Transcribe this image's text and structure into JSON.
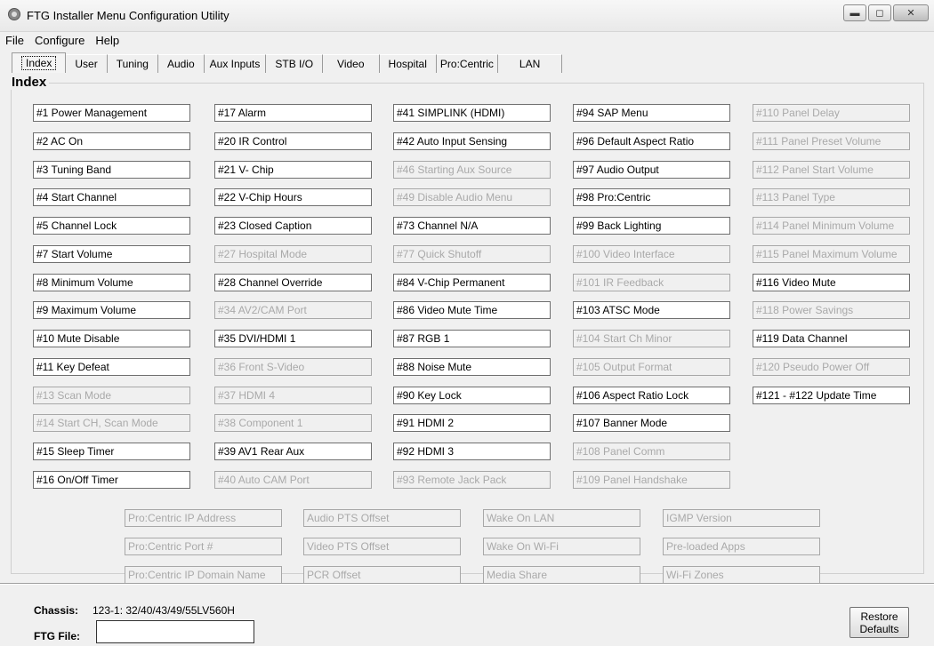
{
  "window": {
    "title": "FTG Installer Menu Configuration Utility"
  },
  "menu": [
    "File",
    "Configure",
    "Help"
  ],
  "tabs": [
    "Index",
    "User",
    "Tuning",
    "Audio",
    "Aux Inputs",
    "STB I/O",
    "Video",
    "Hospital",
    "Pro:Centric",
    "LAN"
  ],
  "active_tab": "Index",
  "group_title": "Index",
  "columns": [
    [
      {
        "label": "#1 Power Management",
        "enabled": true
      },
      {
        "label": "#2 AC On",
        "enabled": true
      },
      {
        "label": "#3 Tuning Band",
        "enabled": true
      },
      {
        "label": "#4 Start Channel",
        "enabled": true
      },
      {
        "label": "#5 Channel Lock",
        "enabled": true
      },
      {
        "label": "#7 Start Volume",
        "enabled": true
      },
      {
        "label": "#8 Minimum Volume",
        "enabled": true
      },
      {
        "label": "#9 Maximum Volume",
        "enabled": true
      },
      {
        "label": "#10 Mute Disable",
        "enabled": true
      },
      {
        "label": "#11 Key Defeat",
        "enabled": true
      },
      {
        "label": "#13 Scan Mode",
        "enabled": false
      },
      {
        "label": "#14 Start CH, Scan Mode",
        "enabled": false
      },
      {
        "label": "#15 Sleep Timer",
        "enabled": true
      },
      {
        "label": "#16 On/Off Timer",
        "enabled": true
      }
    ],
    [
      {
        "label": "#17 Alarm",
        "enabled": true
      },
      {
        "label": "#20 IR Control",
        "enabled": true
      },
      {
        "label": "#21 V- Chip",
        "enabled": true
      },
      {
        "label": "#22 V-Chip Hours",
        "enabled": true
      },
      {
        "label": "#23 Closed Caption",
        "enabled": true
      },
      {
        "label": "#27 Hospital Mode",
        "enabled": false
      },
      {
        "label": "#28 Channel Override",
        "enabled": true
      },
      {
        "label": "#34 AV2/CAM Port",
        "enabled": false
      },
      {
        "label": "#35 DVI/HDMI 1",
        "enabled": true
      },
      {
        "label": "#36 Front S-Video",
        "enabled": false
      },
      {
        "label": "#37 HDMI 4",
        "enabled": false
      },
      {
        "label": "#38 Component 1",
        "enabled": false
      },
      {
        "label": "#39 AV1 Rear Aux",
        "enabled": true
      },
      {
        "label": "#40 Auto CAM Port",
        "enabled": false
      }
    ],
    [
      {
        "label": "#41 SIMPLINK (HDMI)",
        "enabled": true
      },
      {
        "label": "#42 Auto Input Sensing",
        "enabled": true
      },
      {
        "label": "#46 Starting Aux Source",
        "enabled": false
      },
      {
        "label": "#49 Disable Audio Menu",
        "enabled": false
      },
      {
        "label": "#73 Channel N/A",
        "enabled": true
      },
      {
        "label": "#77 Quick Shutoff",
        "enabled": false
      },
      {
        "label": "#84 V-Chip Permanent",
        "enabled": true
      },
      {
        "label": "#86 Video Mute Time",
        "enabled": true
      },
      {
        "label": "#87 RGB 1",
        "enabled": true
      },
      {
        "label": "#88 Noise Mute",
        "enabled": true
      },
      {
        "label": "#90 Key Lock",
        "enabled": true
      },
      {
        "label": "#91 HDMI 2",
        "enabled": true
      },
      {
        "label": "#92 HDMI 3",
        "enabled": true
      },
      {
        "label": "#93 Remote Jack Pack",
        "enabled": false
      }
    ],
    [
      {
        "label": "#94 SAP Menu",
        "enabled": true
      },
      {
        "label": "#96 Default Aspect Ratio",
        "enabled": true
      },
      {
        "label": "#97 Audio Output",
        "enabled": true
      },
      {
        "label": "#98 Pro:Centric",
        "enabled": true
      },
      {
        "label": "#99 Back Lighting",
        "enabled": true
      },
      {
        "label": "#100 Video Interface",
        "enabled": false
      },
      {
        "label": "#101 IR Feedback",
        "enabled": false
      },
      {
        "label": "#103 ATSC Mode",
        "enabled": true
      },
      {
        "label": "#104 Start Ch Minor",
        "enabled": false
      },
      {
        "label": "#105 Output Format",
        "enabled": false
      },
      {
        "label": "#106 Aspect Ratio Lock",
        "enabled": true
      },
      {
        "label": "#107 Banner Mode",
        "enabled": true
      },
      {
        "label": "#108 Panel Comm",
        "enabled": false
      },
      {
        "label": "#109 Panel Handshake",
        "enabled": false
      }
    ],
    [
      {
        "label": "#110 Panel Delay",
        "enabled": false
      },
      {
        "label": "#111 Panel Preset Volume",
        "enabled": false
      },
      {
        "label": "#112 Panel Start Volume",
        "enabled": false
      },
      {
        "label": "#113 Panel Type",
        "enabled": false
      },
      {
        "label": "#114 Panel Minimum Volume",
        "enabled": false
      },
      {
        "label": "#115 Panel Maximum Volume",
        "enabled": false
      },
      {
        "label": "#116 Video Mute",
        "enabled": true
      },
      {
        "label": "#118 Power Savings",
        "enabled": false
      },
      {
        "label": "#119 Data Channel",
        "enabled": true
      },
      {
        "label": "#120 Pseudo Power Off",
        "enabled": false
      },
      {
        "label": "#121 - #122 Update Time",
        "enabled": true
      }
    ]
  ],
  "extra_columns": [
    [
      "Pro:Centric IP Address",
      "Pro:Centric Port #",
      "Pro:Centric IP Domain Name"
    ],
    [
      "Audio PTS Offset",
      "Video PTS Offset",
      "PCR Offset"
    ],
    [
      "Wake On LAN",
      "Wake On  Wi-Fi",
      "Media Share"
    ],
    [
      "IGMP Version",
      "Pre-loaded Apps",
      "Wi-Fi Zones"
    ]
  ],
  "footer": {
    "chassis_label": "Chassis:",
    "chassis_value": "123-1: 32/40/43/49/55LV560H",
    "ftg_label": "FTG File:",
    "ftg_value": "",
    "restore_label_line1": "Restore",
    "restore_label_line2": "Defaults"
  }
}
